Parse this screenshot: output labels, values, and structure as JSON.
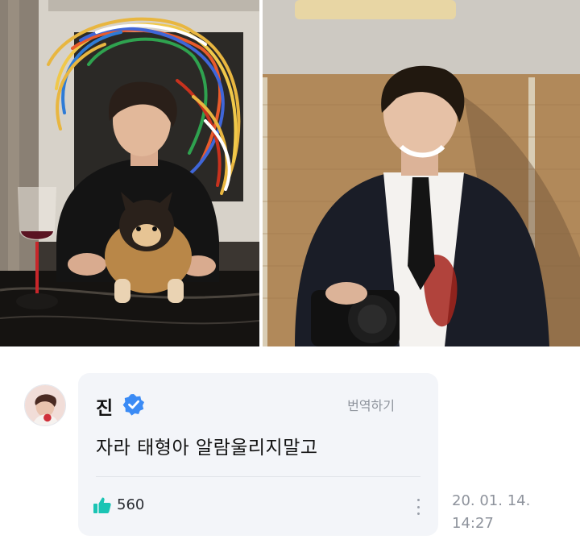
{
  "photos": {
    "left_alt": "photo-left",
    "right_alt": "photo-right"
  },
  "comment": {
    "author": "진",
    "verified_icon": "verified-check-icon",
    "translate_label": "번역하기",
    "text": "자라 태형아 알람울리지말고",
    "like_icon": "thumbs-up-icon",
    "like_count": "560",
    "more_icon": "more-vertical-icon",
    "date": "20. 01. 14.",
    "time": "14:27"
  },
  "colors": {
    "bubble_bg": "#f3f5f9",
    "verified_blue": "#3b8bf5",
    "like_teal": "#1bc4b4",
    "meta_gray": "#8e939c"
  }
}
